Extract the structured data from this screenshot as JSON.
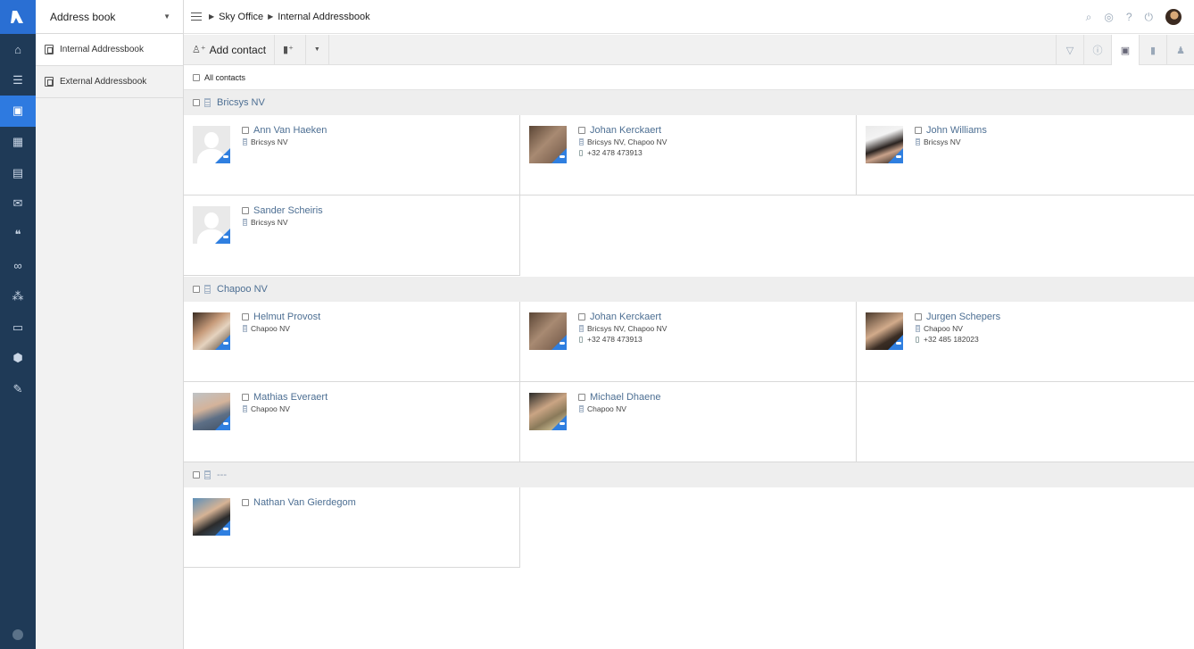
{
  "app": {
    "module_selector": "Address book",
    "breadcrumb": [
      "Sky Office",
      "Internal Addressbook"
    ]
  },
  "sidebar": {
    "icons": [
      "home-icon",
      "tasks-icon",
      "addressbook-icon",
      "calendar-icon",
      "notes-icon",
      "mail-icon",
      "quote-icon",
      "link-icon",
      "org-icon",
      "forms-icon",
      "package-icon",
      "wrench-icon"
    ],
    "active": "addressbook-icon"
  },
  "books": [
    {
      "label": "Internal Addressbook",
      "active": true
    },
    {
      "label": "External Addressbook",
      "active": false
    }
  ],
  "toolbar": {
    "add_contact_label": "Add contact"
  },
  "list": {
    "all_contacts_label": "All contacts"
  },
  "groups": [
    {
      "name": "Bricsys NV",
      "contacts": [
        {
          "name": "Ann Van Haeken",
          "company": "Bricsys NV",
          "phone": "",
          "photo": "placeholder"
        },
        {
          "name": "Johan Kerckaert",
          "company": "Bricsys NV, Chapoo NV",
          "phone": "+32 478 473913",
          "photo": "photo"
        },
        {
          "name": "John Williams",
          "company": "Bricsys NV",
          "phone": "",
          "photo": "photo"
        },
        {
          "name": "Sander Scheiris",
          "company": "Bricsys NV",
          "phone": "",
          "photo": "placeholder"
        }
      ]
    },
    {
      "name": "Chapoo NV",
      "contacts": [
        {
          "name": "Helmut Provost",
          "company": "Chapoo NV",
          "phone": "",
          "photo": "photo"
        },
        {
          "name": "Johan Kerckaert",
          "company": "Bricsys NV, Chapoo NV",
          "phone": "+32 478 473913",
          "photo": "photo"
        },
        {
          "name": "Jurgen Schepers",
          "company": "Chapoo NV",
          "phone": "+32 485 182023",
          "photo": "photo"
        },
        {
          "name": "Mathias Everaert",
          "company": "Chapoo NV",
          "phone": "",
          "photo": "photo"
        },
        {
          "name": "Michael Dhaene",
          "company": "Chapoo NV",
          "phone": "",
          "photo": "photo"
        }
      ]
    },
    {
      "name": "---",
      "contacts": [
        {
          "name": "Nathan Van Gierdegom",
          "company": "",
          "phone": "",
          "photo": "photo"
        }
      ]
    }
  ],
  "colors": {
    "rail_bg": "#1f3a57",
    "accent": "#2e7ae0",
    "link": "#4d6f93"
  }
}
